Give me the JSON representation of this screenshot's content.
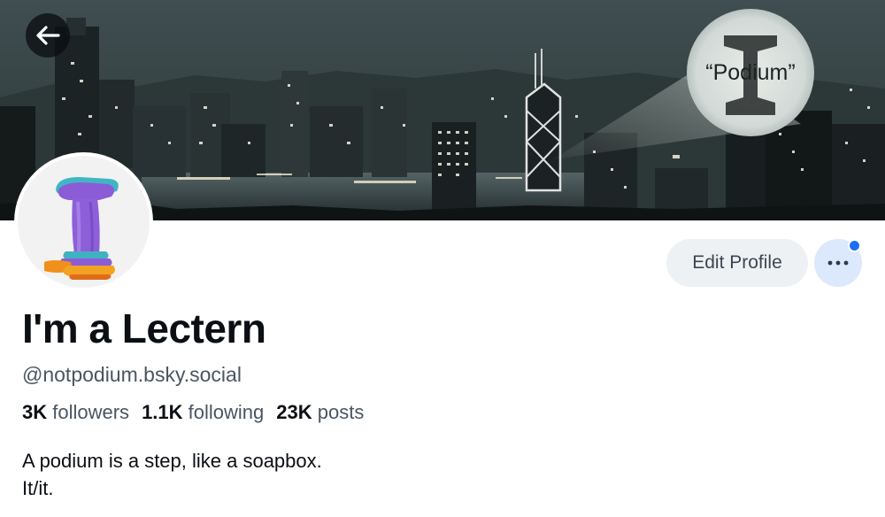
{
  "banner": {
    "signal_text": "“Podium”"
  },
  "profile": {
    "display_name": "I'm a Lectern",
    "handle": "@notpodium.bsky.social",
    "stats": [
      {
        "count": "3K",
        "label": "followers"
      },
      {
        "count": "1.1K",
        "label": "following"
      },
      {
        "count": "23K",
        "label": "posts"
      }
    ],
    "bio_lines": [
      "A podium is a step, like a soapbox.",
      "It/it."
    ]
  },
  "actions": {
    "edit_label": "Edit Profile",
    "more_icon": "ellipsis-icon",
    "back_icon": "arrow-left-icon"
  },
  "colors": {
    "accent": "#1d6ef5",
    "more_button_bg": "#dce8fb",
    "edit_button_bg": "#eef1f4",
    "handle_text": "#4a5563"
  }
}
